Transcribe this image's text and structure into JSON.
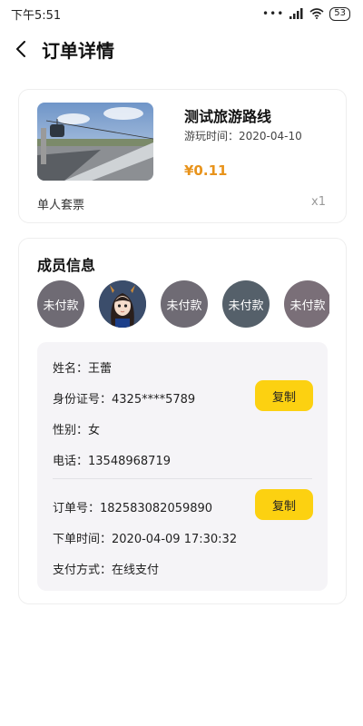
{
  "status": {
    "time": "下午5:51",
    "battery": "53"
  },
  "nav": {
    "title": "订单详情"
  },
  "product": {
    "title": "测试旅游路线",
    "date_label": "游玩时间：",
    "date_value": "2020-04-10",
    "price": "¥0.11",
    "ticket_type": "单人套票",
    "quantity": "x1"
  },
  "members": {
    "title": "成员信息",
    "avatars": [
      {
        "status": "未付款"
      },
      {
        "status": ""
      },
      {
        "status": "未付款"
      },
      {
        "status": "未付款"
      },
      {
        "status": "未付款"
      }
    ]
  },
  "person": {
    "name_label": "姓名：",
    "name": "王蕾",
    "id_label": "身份证号：",
    "id_number": "4325****5789",
    "gender_label": "性别：",
    "gender": "女",
    "phone_label": "电话：",
    "phone": "13548968719",
    "copy_label": "复制"
  },
  "order": {
    "number_label": "订单号：",
    "number": "182583082059890",
    "time_label": "下单时间：",
    "time": "2020-04-09 17:30:32",
    "payment_label": "支付方式：",
    "payment": "在线支付",
    "copy_label": "复制"
  },
  "colors": {
    "accent": "#fcd111",
    "price": "#e8931b"
  }
}
